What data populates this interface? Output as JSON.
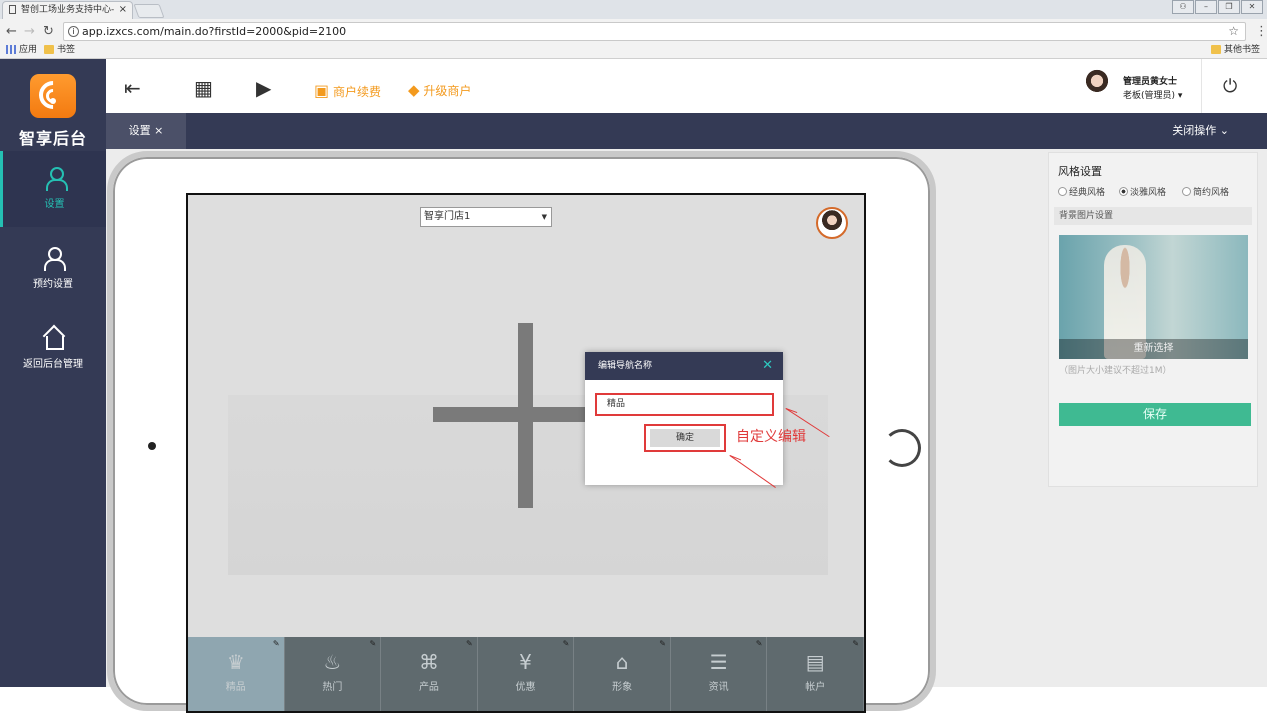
{
  "browser": {
    "tab_title": "智创工场业务支持中心-",
    "url": "app.izxcs.com/main.do?firstId=2000&pid=2100",
    "bookmarks": [
      "应用",
      "书签"
    ],
    "other_bookmarks": "其他书签"
  },
  "sidebar": {
    "brand": "智享后台",
    "items": [
      {
        "label": "设置",
        "icon": "person-icon",
        "active": true
      },
      {
        "label": "预约设置",
        "icon": "person-icon",
        "active": false
      },
      {
        "label": "返回后台管理",
        "icon": "home-icon",
        "active": false
      }
    ]
  },
  "header": {
    "renew": "商户续费",
    "upgrade": "升级商户",
    "user_name": "管理员黄女士",
    "user_role": "老板(管理员) ▾"
  },
  "tabs": {
    "active": "设置 ×",
    "close_ops": "关闭操作 ⌄"
  },
  "preview": {
    "store": "智享门店1",
    "nav": [
      "精品",
      "热门",
      "产品",
      "优惠",
      "形象",
      "资讯",
      "帐户"
    ]
  },
  "panel": {
    "title": "风格设置",
    "styles": [
      {
        "label": "经典风格",
        "selected": false
      },
      {
        "label": "淡雅风格",
        "selected": true
      },
      {
        "label": "简约风格",
        "selected": false
      }
    ],
    "bg_title": "背景图片设置",
    "reselect": "重新选择",
    "hint": "（图片大小建议不超过1M）",
    "save": "保存"
  },
  "modal": {
    "title": "编辑导航名称",
    "input_value": "精品",
    "ok": "确定",
    "annotation": "自定义编辑"
  },
  "colors": {
    "sidebar": "#343a55",
    "accent": "#25c0b3",
    "orange": "#f39a1e",
    "save": "#3fba92",
    "annotation": "#e03a3a"
  }
}
